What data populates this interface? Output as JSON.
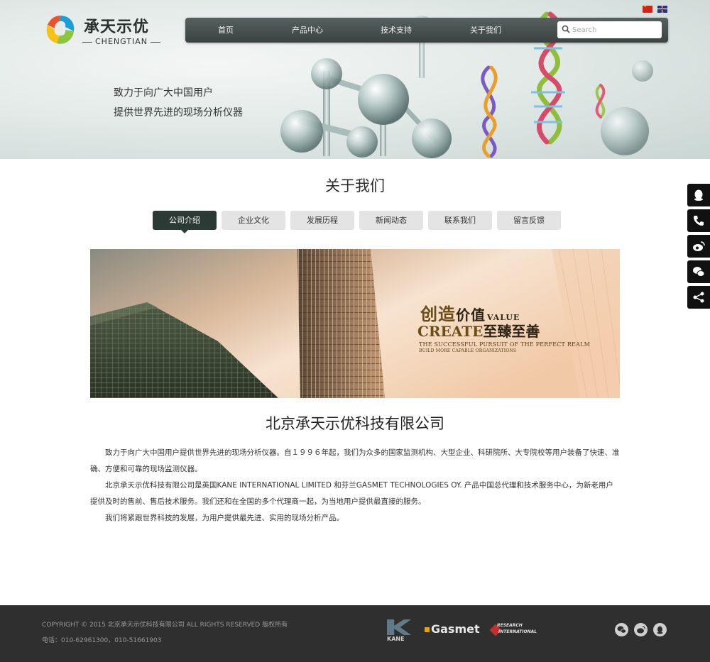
{
  "brand": {
    "name_cn": "承天示优",
    "name_en": "CHENGTIAN"
  },
  "nav": {
    "items": [
      {
        "label": "首页"
      },
      {
        "label": "产品中心"
      },
      {
        "label": "技术支持"
      },
      {
        "label": "关于我们"
      }
    ],
    "search_placeholder": "Search"
  },
  "hero": {
    "slogan_line1": "致力于向广大中国用户",
    "slogan_line2": "提供世界先进的现场分析仪器"
  },
  "section": {
    "title": "关于我们",
    "tabs": [
      {
        "label": "公司介绍",
        "active": true
      },
      {
        "label": "企业文化",
        "active": false
      },
      {
        "label": "发展历程",
        "active": false
      },
      {
        "label": "新闻动态",
        "active": false
      },
      {
        "label": "联系我们",
        "active": false
      },
      {
        "label": "留言反馈",
        "active": false
      }
    ]
  },
  "banner": {
    "cn_line1_a": "创造",
    "cn_line1_b": "价值",
    "cn_line1_en": "VALUE",
    "cn_line2_a": "CREATE",
    "cn_line2_b": "至臻至善",
    "en_line1": "THE SUCCESSFUL PURSUIT OF THE PERFECT REALM",
    "en_line2": "BUILD MORE CAPABLE ORGANIZATIONS"
  },
  "company": {
    "name": "北京承天示优科技有限公司",
    "paragraphs": [
      "致力于向广大中国用户提供世界先进的现场分析仪器。自１９９６年起，我们为众多的国家监测机构、大型企业、科研院所、大专院校等用户装备了快速、准确、方便和可靠的现场监测仪器。",
      "北京承天示优科技有限公司是英国KANE INTERNATIONAL LIMITED 和芬兰GASMET TECHNOLOGIES OY. 产品中国总代理和技术服务中心，为新老用户提供及时的售前、售后技术服务。我们还和在全国的多个代理商一起，为当地用户提供最直接的服务。",
      "我们将紧跟世界科技的发展，为用户提供最先进、实用的现场分析产品。"
    ]
  },
  "footer": {
    "copyright": "COPYRIGHT © 2015 北京承天示优科技有限公司 ALL RIGHTS RESERVED 版权所有",
    "phone": "电话：010-62961300，010-51661903",
    "partners": {
      "kane": "KANE",
      "gasmet": "Gasmet",
      "ri_line1": "RESEARCH",
      "ri_line2": "INTERNATIONAL"
    }
  },
  "float_toolbar": [
    "qq-icon",
    "phone-icon",
    "weibo-icon",
    "wechat-icon",
    "share-icon"
  ],
  "colors": {
    "nav_bg": "#3f4846",
    "tab_active": "#2c3a35",
    "tab_inactive": "#e4e4e4",
    "footer_bg": "#2f2f2f",
    "float_bg": "#111111"
  }
}
